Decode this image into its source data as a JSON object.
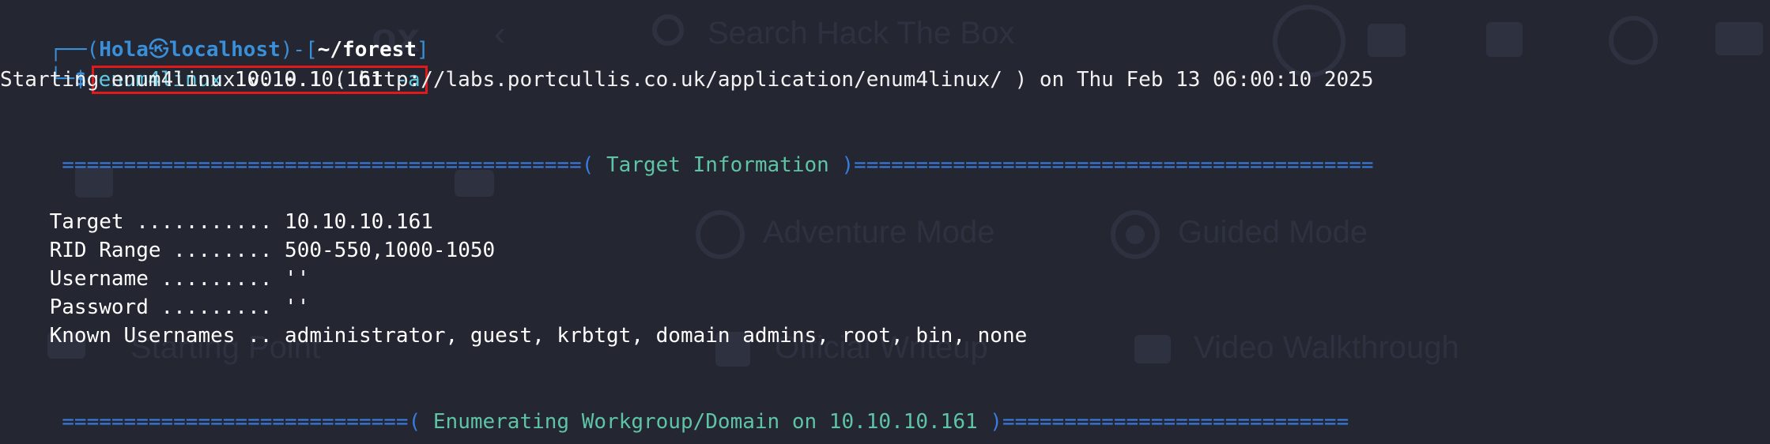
{
  "prompt": {
    "top_prefix": "┌──(",
    "user": "Hola",
    "separator": "㉿",
    "host": "localhost",
    "mid": ")-[",
    "path": "~/forest",
    "close": "]",
    "bottom_prefix": "└─",
    "dollar": "$"
  },
  "command": {
    "name": "enum4linux",
    "target": "10.10.10.161",
    "flag": "-a"
  },
  "output": {
    "starting_line": "Starting enum4linux v0.9.1 ( http://labs.portcullis.co.uk/application/enum4linux/ ) on Thu Feb 13 06:00:10 2025",
    "banner1": {
      "left": " ==========================================( ",
      "title": "Target Information",
      "right": " )=========================================="
    },
    "info_lines": [
      {
        "key": "Target ........... ",
        "value": "10.10.10.161"
      },
      {
        "key": "RID Range ........ ",
        "value": "500-550,1000-1050"
      },
      {
        "key": "Username ......... ",
        "value": "''"
      },
      {
        "key": "Password ......... ",
        "value": "''"
      },
      {
        "key": "Known Usernames .. ",
        "value": "administrator, guest, krbtgt, domain admins, root, bin, none"
      }
    ],
    "banner2": {
      "left": " ============================( ",
      "title": "Enumerating Workgroup/Domain on 10.10.10.161",
      "right": " )============================"
    }
  },
  "background_ghost": {
    "search_placeholder": "Search Hack The Box",
    "adventure_mode": "Adventure Mode",
    "guided_mode": "Guided Mode",
    "starting_point": "Starting Point",
    "official_writeup": "Official Writeup",
    "video_walkthrough": "Video Walkthrough",
    "logo_text": "ox"
  },
  "colors": {
    "background": "#242631",
    "prompt_blue": "#3a8fd9",
    "command_cyan": "#5fc8e0",
    "banner_blue": "#3a7be0",
    "banner_title_green": "#5ec4a6",
    "highlight_red": "#e01a1a"
  }
}
